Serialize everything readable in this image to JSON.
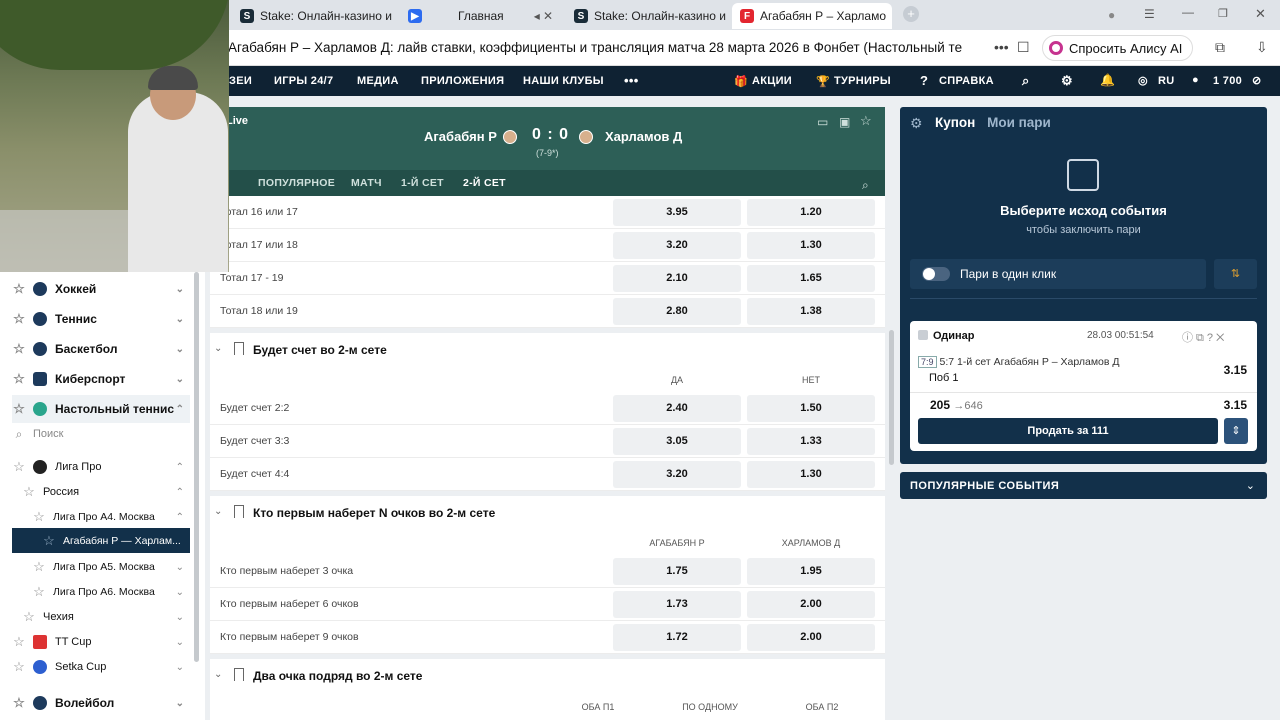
{
  "browser": {
    "tabs": [
      {
        "label": "Stake: Онлайн-казино и с",
        "icon": "stake-icon"
      },
      {
        "label": "Главная",
        "icon": "play-icon"
      },
      {
        "label": "Stake: Онлайн-казино и с",
        "icon": "stake-icon"
      },
      {
        "label": "Агабабян Р – Харламо",
        "icon": "fonbet-icon"
      }
    ],
    "page_title": "Агабабян Р – Харламов Д: лайв ставки, коэффициенты и трансляция матча 28 марта 2026 в Фонбет (Настольный теннис, Россия....",
    "alice_label": "Спросить Алису AI"
  },
  "site_nav": {
    "items": [
      "ЗЕИ",
      "ИГРЫ 24/7",
      "МЕДИА",
      "ПРИЛОЖЕНИЯ",
      "НАШИ КЛУБЫ",
      "•••"
    ],
    "right": [
      "АКЦИИ",
      "ТУРНИРЫ",
      "СПРАВКА",
      "RU",
      "1 700"
    ]
  },
  "left_nav": {
    "sports": [
      "Хоккей",
      "Теннис",
      "Баскетбол",
      "Киберспорт",
      "Настольный теннис"
    ],
    "search_placeholder": "Поиск",
    "tree": [
      "Лига Про",
      "Россия",
      "Лига Про А4. Москва",
      "Агабабян Р — Харлам...",
      "Лига Про А5. Москва",
      "Лига Про А6. Москва",
      "Чехия",
      "TT Cup",
      "Setka Cup",
      "Волейбол"
    ]
  },
  "event": {
    "live": "Live",
    "team_a": "Агабабян Р",
    "team_b": "Харламов Д",
    "score": "0 : 0",
    "sub": "(7-9*)",
    "tabs": [
      "ПОПУЛЯРНОЕ",
      "МАТЧ",
      "1-Й СЕТ",
      "2-Й СЕТ"
    ]
  },
  "market": {
    "totals": [
      {
        "label": "Тотал 16 или 17",
        "a": "3.95",
        "b": "1.20"
      },
      {
        "label": "Тотал 17 или 18",
        "a": "3.20",
        "b": "1.30"
      },
      {
        "label": "Тотал 17 - 19",
        "a": "2.10",
        "b": "1.65"
      },
      {
        "label": "Тотал 18 или 19",
        "a": "2.80",
        "b": "1.38"
      }
    ],
    "sec1": {
      "title": "Будет счет во 2-м сете",
      "col_a": "ДА",
      "col_b": "НЕТ",
      "rows": [
        {
          "label": "Будет счет 2:2",
          "a": "2.40",
          "b": "1.50"
        },
        {
          "label": "Будет счет 3:3",
          "a": "3.05",
          "b": "1.33"
        },
        {
          "label": "Будет счет 4:4",
          "a": "3.20",
          "b": "1.30"
        }
      ]
    },
    "sec2": {
      "title": "Кто первым наберет N очков во 2-м сете",
      "col_a": "АГАБАБЯН Р",
      "col_b": "ХАРЛАМОВ Д",
      "rows": [
        {
          "label": "Кто первым наберет 3 очка",
          "a": "1.75",
          "b": "1.95"
        },
        {
          "label": "Кто первым наберет 6 очков",
          "a": "1.73",
          "b": "2.00"
        },
        {
          "label": "Кто первым наберет 9 очков",
          "a": "1.72",
          "b": "2.00"
        }
      ]
    },
    "sec3": {
      "title": "Два очка подряд во 2-м сете",
      "cols": [
        "ОБА П1",
        "ПО ОДНОМУ",
        "ОБА П2"
      ]
    }
  },
  "coupon": {
    "tab1": "Купон",
    "tab2": "Мои пари",
    "heading": "Выберите исход события",
    "subheading": "чтобы заключить пари",
    "one_click": "Пари в один клик",
    "slip_type": "Одинар",
    "slip_time": "28.03  00:51:54",
    "slip_tag": "7:9",
    "slip_event": "5:7 1-й сет Агабабян Р – Харламов Д",
    "slip_outcome": "Поб 1",
    "slip_odd": "3.15",
    "stake_from": "205",
    "stake_to": "646",
    "stake_odd": "3.15",
    "sell_label": "Продать за 111"
  },
  "popular": {
    "label": "ПОПУЛЯРНЫЕ СОБЫТИЯ"
  }
}
